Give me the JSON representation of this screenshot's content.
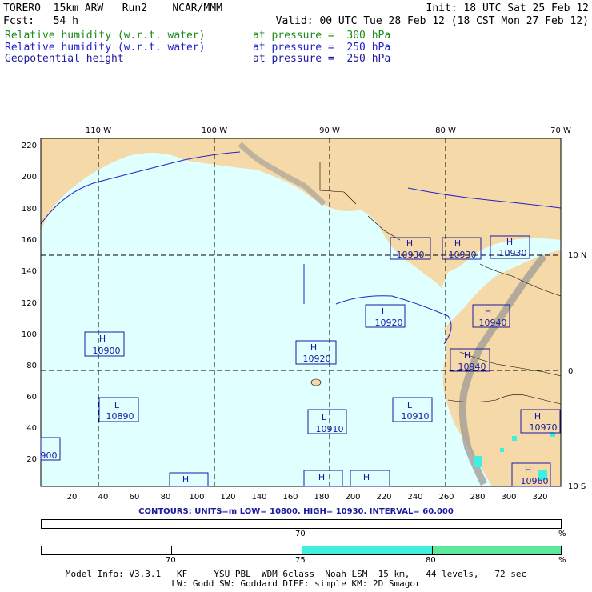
{
  "header": {
    "line1_left": "TORERO  15km ARW   Run2    NCAR/MMM",
    "line1_right": "Init: 18 UTC Sat 25 Feb 12",
    "line2_left": "Fcst:   54 h",
    "line2_right": "Valid: 00 UTC Tue 28 Feb 12 (18 CST Mon 27 Feb 12)",
    "fields": [
      {
        "name": "Relative humidity (w.r.t. water)",
        "level": "at pressure =  300 hPa",
        "color": "#1a8a1a"
      },
      {
        "name": "Relative humidity (w.r.t. water)",
        "level": "at pressure =  250 hPa",
        "color": "#2222cc"
      },
      {
        "name": "Geopotential height",
        "level": "at pressure =  250 hPa",
        "color": "#1a1aa0"
      }
    ]
  },
  "map": {
    "top_lon_labels": [
      "110 W",
      "100 W",
      "90 W",
      "80 W",
      "70 W"
    ],
    "right_lat_labels": [
      "10 N",
      "0",
      "10 S"
    ],
    "y_ticks": [
      "220",
      "200",
      "180",
      "160",
      "140",
      "120",
      "100",
      "80",
      "60",
      "40",
      "20"
    ],
    "x_ticks": [
      "20",
      "40",
      "60",
      "80",
      "100",
      "120",
      "140",
      "160",
      "180",
      "200",
      "220",
      "240",
      "260",
      "280",
      "300",
      "320"
    ],
    "ocean_color": "#e0ffff",
    "land_color": "#f5d9a8",
    "highlights": [
      {
        "type": "H",
        "value": "10930"
      },
      {
        "type": "H",
        "value": "10930"
      },
      {
        "type": "H",
        "value": "10930"
      },
      {
        "type": "L",
        "value": "10920"
      },
      {
        "type": "H",
        "value": "10940"
      },
      {
        "type": "H",
        "value": "10900"
      },
      {
        "type": "H",
        "value": "10920"
      },
      {
        "type": "H",
        "value": "10940"
      },
      {
        "type": "L",
        "value": "10890"
      },
      {
        "type": "L",
        "value": "10910"
      },
      {
        "type": "L",
        "value": "10910"
      },
      {
        "type": "H",
        "value": "10970"
      },
      {
        "type": "",
        "value": "900"
      },
      {
        "type": "H",
        "value": "10960"
      },
      {
        "type": "H",
        "value": ""
      },
      {
        "type": "H",
        "value": ""
      },
      {
        "type": "H",
        "value": ""
      }
    ]
  },
  "contours": {
    "text": "CONTOURS:  UNITS=m  LOW=  10800.        HIGH=  10930.        INTERVAL=   60.000"
  },
  "bar1": {
    "label": "70",
    "unit": "%",
    "fill_color": "#ffffff"
  },
  "bar2": {
    "labels": [
      "70",
      "75",
      "80"
    ],
    "unit": "%",
    "colors": [
      "#3ff0e0",
      "#5ee89a"
    ]
  },
  "footer": {
    "line1": "Model Info: V3.3.1   KF     YSU PBL  WDM 6class  Noah LSM  15 km,   44 levels,   72 sec",
    "line2": "LW: Godd SW: Goddard DIFF: simple KM: 2D Smagor"
  }
}
